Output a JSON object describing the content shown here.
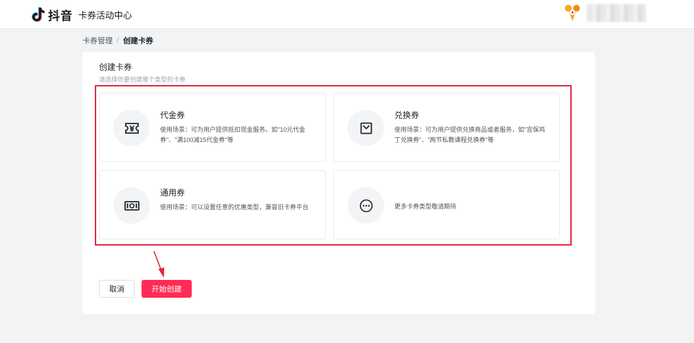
{
  "header": {
    "brand": "抖音",
    "subtitle": "卡券活动中心",
    "user_name": "",
    "colors": {
      "tiktok_dark": "#161823",
      "tiktok_cyan": "#25f4ee",
      "tiktok_red": "#fe2c55",
      "partner_orange": "#f5a623"
    }
  },
  "breadcrumb": {
    "parent": "卡券管理",
    "separator": "/",
    "current": "创建卡券"
  },
  "panel": {
    "title": "创建卡券",
    "hint": "请选择你要创建哪个类型的卡券"
  },
  "cards": [
    {
      "title": "代金券",
      "desc": "使用场景：可为用户提供抵扣现金服务。如\"10元代金券\"、\"满100减15代金券\"等",
      "icon": "yen-ticket-icon"
    },
    {
      "title": "兑换券",
      "desc": "使用场景：可为用户提供兑换商品或者服务，如\"宫保鸡丁兑换券\"、\"两节私教课程兑换券\"等",
      "icon": "envelope-icon"
    },
    {
      "title": "通用券",
      "desc": "使用场景：可以设置任意的优惠类型，兼容旧卡券平台",
      "icon": "cash-icon"
    },
    {
      "title": "",
      "desc": "更多卡券类型敬请期待",
      "icon": "more-icon"
    }
  ],
  "actions": {
    "cancel": "取消",
    "start": "开始创建",
    "primary_color": "#fe2c55"
  },
  "annotation_color": "#e0263b"
}
